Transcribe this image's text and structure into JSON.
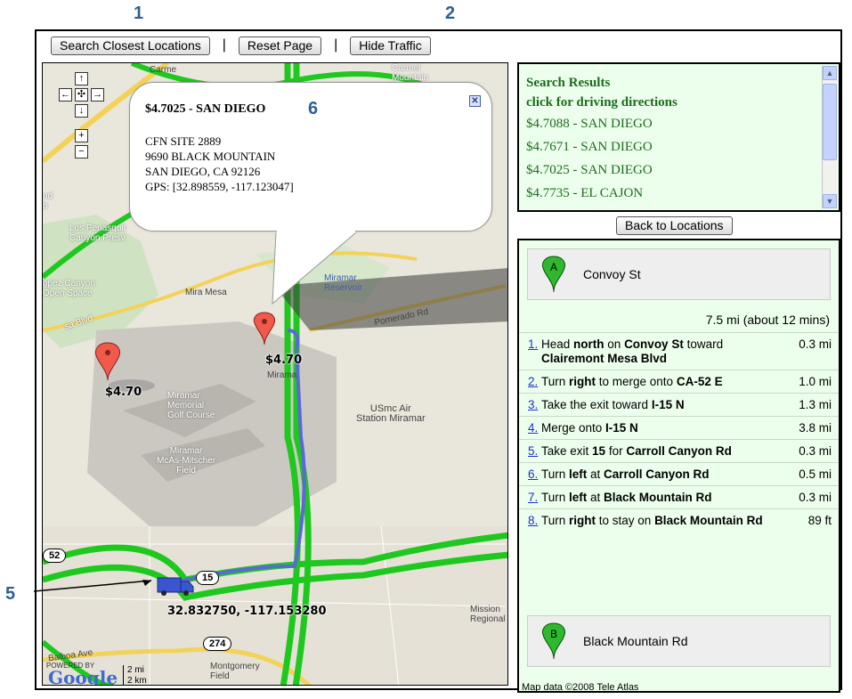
{
  "callouts": {
    "c1": "1",
    "c2": "2",
    "c5": "5",
    "c6": "6"
  },
  "toolbar": {
    "search_label": "Search Closest Locations",
    "reset_label": "Reset Page",
    "hide_traffic_label": "Hide Traffic",
    "separator": "|"
  },
  "map": {
    "labels": {
      "carmel_mountain": "Carmel\nMountain",
      "carmel": "Carme",
      "los_penasquitos": "Los Penasquit\nCanyon Presv",
      "lopez_canyon": "opez Canyon\nOpen Space",
      "mira_mesa": "Mira Mesa",
      "mira_mesa_blvd": "sa Blvd",
      "miramar_reservoir": "Miramar\nReservoir",
      "pomerado": "Pomerado Rd",
      "miramar": "Mirama",
      "miramar_memorial": "Miramar\nMemorial\nGolf Course",
      "usmc": "USmc Air\nStation Miramar",
      "mcas": "Miramar\nMcAs-Mitscher\nField",
      "mission": "Mission\nRegional",
      "montgomery": "Montgomery\nField",
      "balboa": "Balboa Ave",
      "powered_by": "POWERED BY",
      "google": "Google",
      "scale_mi": "2 mi",
      "scale_km": "2 km",
      "nd": "nd\nb",
      "route_274": "274",
      "route_52": "52",
      "route_15": "15"
    },
    "price_label_1": "$4.70",
    "price_label_2": "$4.70",
    "truck_coords": "32.832750, -117.153280",
    "nav_icons": [
      "arrow-up-icon",
      "arrow-left-icon",
      "pan-center-icon",
      "arrow-right-icon",
      "arrow-down-icon",
      "zoom-in-icon",
      "zoom-out-icon"
    ],
    "nav_glyphs": {
      "up": "↑",
      "left": "←",
      "center": "✣",
      "right": "→",
      "down": "↓",
      "plus": "+",
      "minus": "−"
    }
  },
  "bubble": {
    "title": "$4.7025 - SAN DIEGO",
    "close_glyph": "✕",
    "lines": [
      "CFN SITE 2889",
      "9690 BLACK MOUNTAIN",
      "SAN DIEGO, CA 92126",
      "GPS: [32.898559, -117.123047]"
    ]
  },
  "results": {
    "heading1": "Search Results",
    "heading2": "click for driving directions",
    "items": [
      "$4.7088 - SAN DIEGO",
      "$4.7671 - SAN DIEGO",
      "$4.7025 - SAN DIEGO",
      "$4.7735 - EL CAJON"
    ]
  },
  "back_button": "Back to Locations",
  "directions": {
    "start": {
      "marker": "A",
      "label": "Convoy St"
    },
    "summary": "7.5 mi (about 12 mins)",
    "steps": [
      {
        "n": "1.",
        "parts": [
          [
            "Head ",
            false
          ],
          [
            "north",
            true
          ],
          [
            " on ",
            false
          ],
          [
            "Convoy St",
            true
          ],
          [
            " toward ",
            false
          ],
          [
            "Clairemont Mesa Blvd",
            true
          ]
        ],
        "dist": "0.3 mi"
      },
      {
        "n": "2.",
        "parts": [
          [
            "Turn ",
            false
          ],
          [
            "right",
            true
          ],
          [
            " to merge onto ",
            false
          ],
          [
            "CA-52 E",
            true
          ]
        ],
        "dist": "1.0 mi"
      },
      {
        "n": "3.",
        "parts": [
          [
            "Take the exit toward ",
            false
          ],
          [
            "I-15 N",
            true
          ]
        ],
        "dist": "1.3 mi"
      },
      {
        "n": "4.",
        "parts": [
          [
            "Merge onto ",
            false
          ],
          [
            "I-15 N",
            true
          ]
        ],
        "dist": "3.8 mi"
      },
      {
        "n": "5.",
        "parts": [
          [
            "Take exit ",
            false
          ],
          [
            "15",
            true
          ],
          [
            " for ",
            false
          ],
          [
            "Carroll Canyon Rd",
            true
          ]
        ],
        "dist": "0.3 mi"
      },
      {
        "n": "6.",
        "parts": [
          [
            "Turn ",
            false
          ],
          [
            "left",
            true
          ],
          [
            " at ",
            false
          ],
          [
            "Carroll Canyon Rd",
            true
          ]
        ],
        "dist": "0.5 mi"
      },
      {
        "n": "7.",
        "parts": [
          [
            "Turn ",
            false
          ],
          [
            "left",
            true
          ],
          [
            " at ",
            false
          ],
          [
            "Black Mountain Rd",
            true
          ]
        ],
        "dist": "0.3 mi"
      },
      {
        "n": "8.",
        "parts": [
          [
            "Turn ",
            false
          ],
          [
            "right",
            true
          ],
          [
            " to stay on ",
            false
          ],
          [
            "Black Mountain Rd",
            true
          ]
        ],
        "dist": "89 ft"
      }
    ],
    "end": {
      "marker": "B",
      "label": "Black Mountain Rd"
    },
    "copyright": "Map data ©2008 Tele Atlas"
  },
  "colors": {
    "highway_green": "#1fc81f",
    "route_blue": "#5a68d8",
    "results_bg": "#ecffec",
    "results_text": "#1e6b1e",
    "callout_blue": "#2f5f96"
  }
}
